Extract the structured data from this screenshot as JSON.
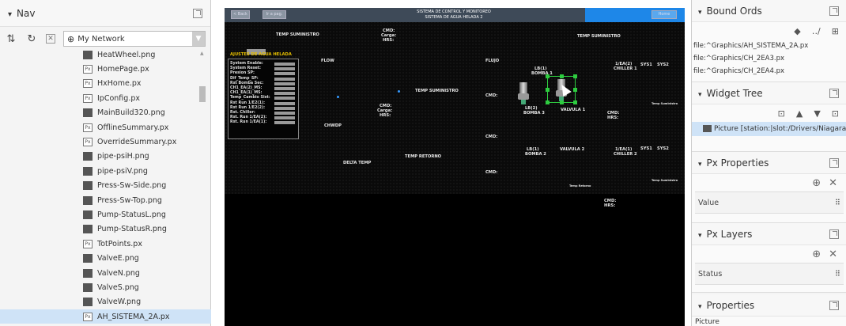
{
  "nav": {
    "title": "Nav",
    "network_label": "My Network",
    "files": [
      {
        "name": "HeatWheel.png",
        "type": "img"
      },
      {
        "name": "HomePage.px",
        "type": "px"
      },
      {
        "name": "HxHome.px",
        "type": "px"
      },
      {
        "name": "IpConfig.px",
        "type": "px"
      },
      {
        "name": "MainBuild320.png",
        "type": "img"
      },
      {
        "name": "OfflineSummary.px",
        "type": "px"
      },
      {
        "name": "OverrideSummary.px",
        "type": "px"
      },
      {
        "name": "pipe-psiH.png",
        "type": "img"
      },
      {
        "name": "pipe-psiV.png",
        "type": "img"
      },
      {
        "name": "Press-Sw-Side.png",
        "type": "img"
      },
      {
        "name": "Press-Sw-Top.png",
        "type": "img"
      },
      {
        "name": "Pump-StatusL.png",
        "type": "img"
      },
      {
        "name": "Pump-StatusR.png",
        "type": "img"
      },
      {
        "name": "TotPoints.px",
        "type": "px"
      },
      {
        "name": "ValveE.png",
        "type": "img"
      },
      {
        "name": "ValveN.png",
        "type": "img"
      },
      {
        "name": "ValveS.png",
        "type": "img"
      },
      {
        "name": "ValveW.png",
        "type": "img"
      },
      {
        "name": "AH_SISTEMA_2A.px",
        "type": "px",
        "selected": true
      }
    ]
  },
  "graphic": {
    "title_line1": "SISTEMA DE CONTROL Y MONITOREO",
    "title_line2": "SISTEMA DE AGUA HELADA 2",
    "btn_back": "< Back",
    "btn_page": "Ir a pag.",
    "btn_home": "Home",
    "labels": {
      "temp_suministro": "TEMP SUMINISTRO",
      "temp_retorno": "TEMP RETORNO",
      "delta_temp": "DELTA TEMP",
      "chwdp": "CHWDP",
      "cmd": "CMD:",
      "carga": "Carga:",
      "hrs": "HRS:",
      "flow": "FLOW",
      "flujo": "FLUJO",
      "bomba1": "BOMBA 1",
      "bomba2": "BOMBA 2",
      "bomba3": "BOMBA 3",
      "valvula1": "VALVULA 1",
      "valvula2": "VALVULA 2",
      "chiller1": "CHILLER 1",
      "chiller2": "CHILLER 2",
      "ea1": "1/EA(2)",
      "ea2": "1/EA(1)",
      "lb1": "LB(1)",
      "lb2": "LB(2)",
      "lb3": "LB(1)",
      "sys1": "SYS1",
      "sys2": "SYS2",
      "temp_sum_small": "Temp Suministro",
      "temp_ret_small": "Temp Retorno"
    },
    "settings": {
      "header": "AJUSTES DE AGUA HELADA",
      "rows": [
        "System Enable:",
        "System Reset:",
        "Presion SP:",
        "Dif_Temp_SP:",
        "Rst Bomba Sec:",
        "CH1_EA(2)_MS:",
        "CH1_EA(1)_MS:",
        "Temp_Cambio Sist:",
        "Rst Run 1/E2(1):",
        "Rst Run 1/E2(2):",
        "Rst. Chiller:",
        "Rst. Run 1/EA(2):",
        "Rst. Run 1/EA(1):"
      ]
    }
  },
  "side": {
    "bound_ords": {
      "title": "Bound Ords",
      "items": [
        "file:^Graphics/AH_SISTEMA_2A.px",
        "file:^Graphics/CH_2EA3.px",
        "file:^Graphics/CH_2EA4.px"
      ]
    },
    "widget_tree": {
      "title": "Widget Tree",
      "item": "Picture [station:|slot:/Drivers/Niagara"
    },
    "px_properties": {
      "title": "Px Properties",
      "row": "Value"
    },
    "px_layers": {
      "title": "Px Layers",
      "row": "Status"
    },
    "properties": {
      "title": "Properties",
      "row": "Picture"
    }
  },
  "colors": {
    "accent_blue": "#1e87e8",
    "selection_green": "#2ecc40",
    "selected_row": "#cfe3f7",
    "yellow_label": "#e8c000"
  }
}
